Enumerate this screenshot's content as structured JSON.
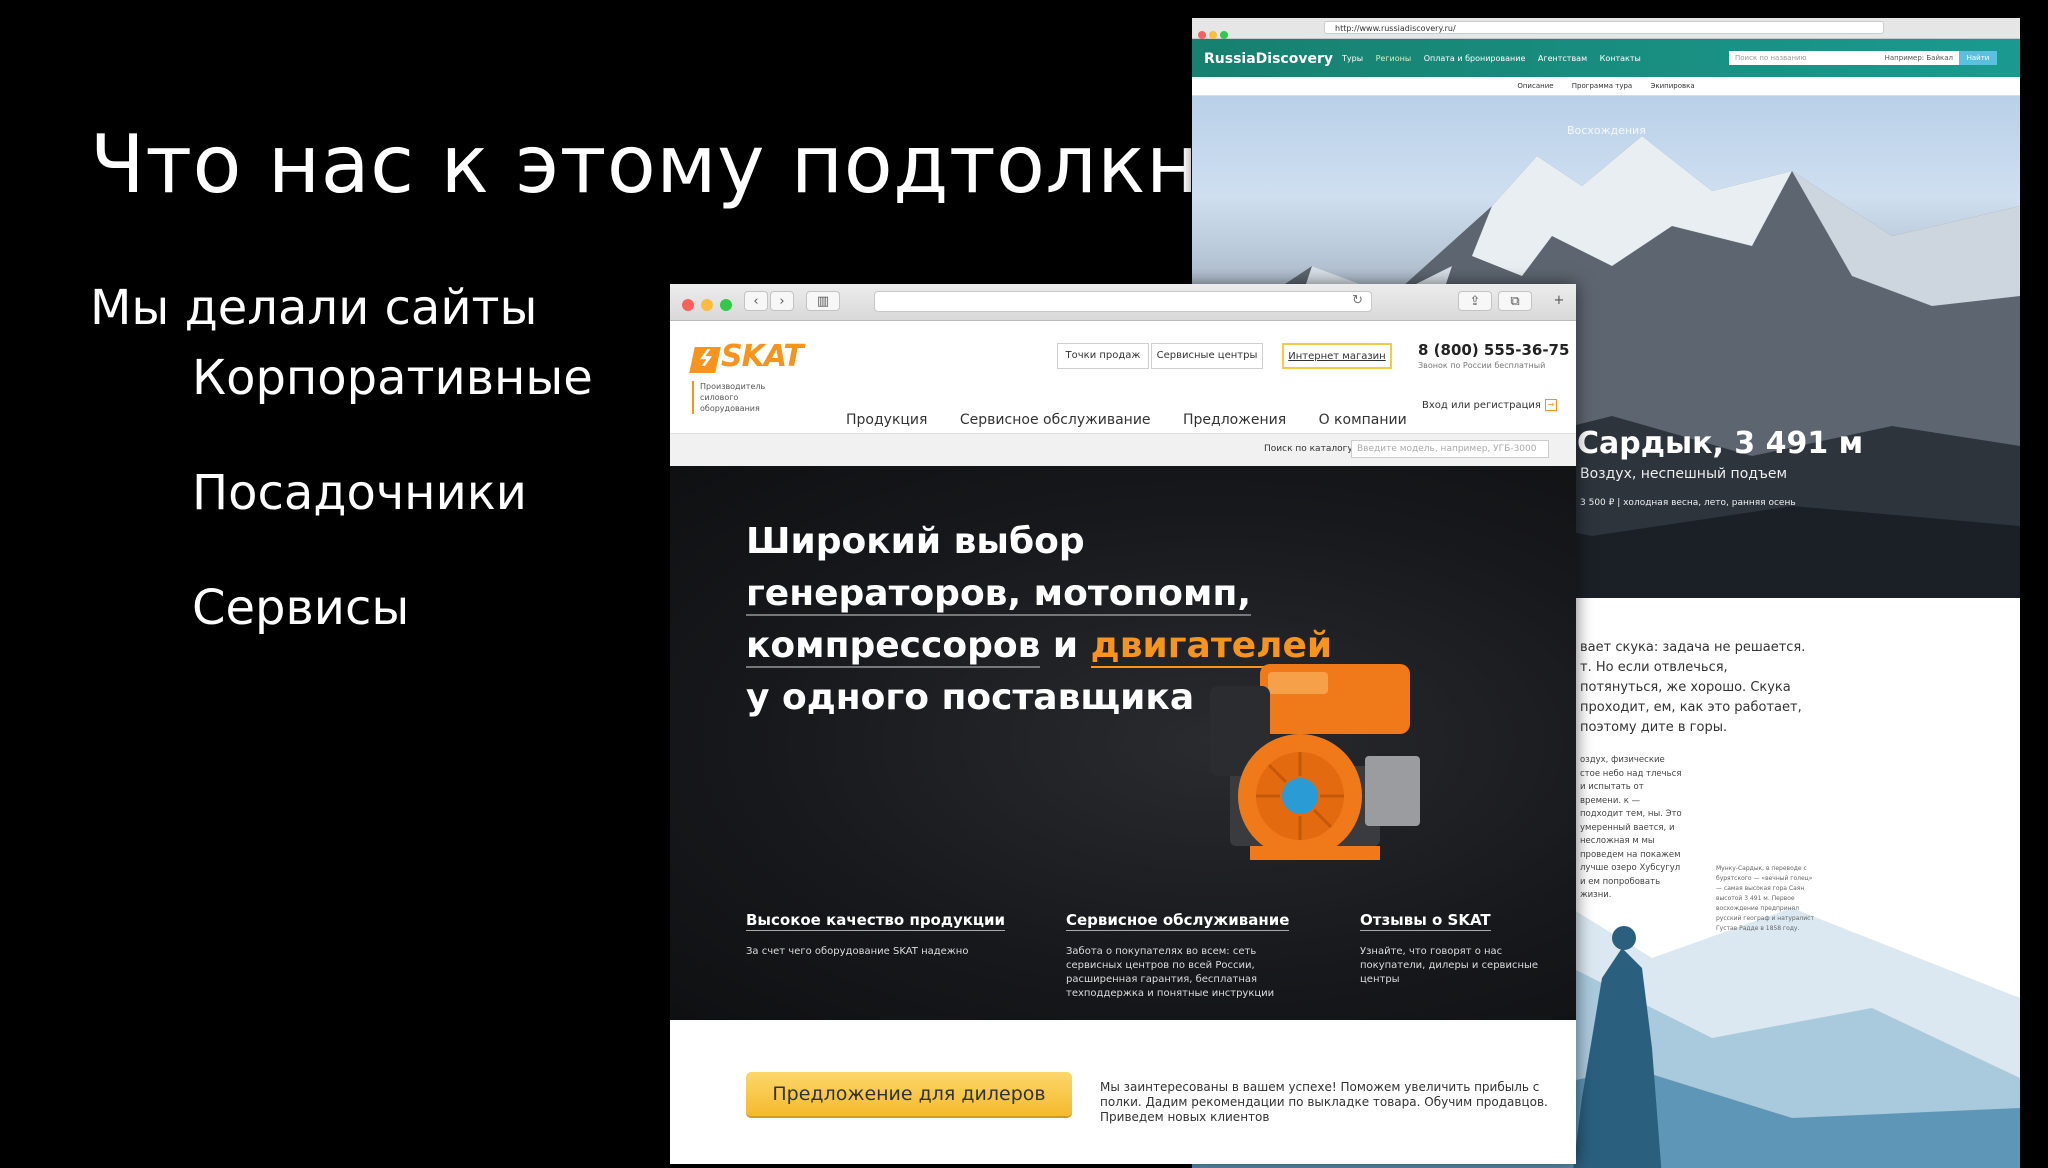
{
  "slide": {
    "title": "Что нас к этому подтолкнуло",
    "subtitle": "Мы делали сайты",
    "items": [
      "Корпоративные",
      "Посадочники",
      "Сервисы"
    ]
  },
  "back_site": {
    "url": "http://www.russiadiscovery.ru/",
    "logo": "RussiaDiscovery",
    "menu": [
      "Туры",
      "Регионы",
      "Оплата и бронирование",
      "Агентствам",
      "Контакты"
    ],
    "search_placeholder": "Поиск по названию",
    "search_label": "Например: Байкал",
    "search_button": "Найти",
    "subnav": [
      "Описание",
      "Программа тура",
      "Экипировка"
    ],
    "hero_top": "Восхождения",
    "hero_title": "Сардык, 3 491 м",
    "hero_subtitle": "Воздух, неспешный подъем",
    "hero_meta": "3 500 ₽   |   холодная весна, лето, ранняя осень",
    "body_text": "вает скука: задача не решается. т. Но если отвлечься, потянуться, же хорошо. Скука проходит, ем, как это работает, поэтому дите в горы.",
    "body_text2": "оздух, физические стое небо над тлечься и испытать от времени. к — подходит тем, ны. Это умеренный вается, и несложная м мы проведем на покажем лучше озеро Хубсугул и ем попробовать жизни.",
    "side_note": "Мунку-Сардык, в переводе с бурятского — «вечный голец» — самая высокая гора Саян высотой 3 491 м. Первое восхождение предпринял русский географ и натуралист Густав Радде в 1858 году."
  },
  "front_site": {
    "logo": "SKAT",
    "tagline": "Производитель силового оборудования",
    "top_buttons": [
      "Точки продаж",
      "Сервисные центры",
      "Интернет магазин"
    ],
    "phone": "8 (800) 555-36-75",
    "phone_note": "Звонок по России бесплатный",
    "login": "Вход или регистрация",
    "menu": [
      "Продукция",
      "Сервисное обслуживание",
      "Предложения",
      "О компании"
    ],
    "search_label": "Поиск по каталогу",
    "search_placeholder": "Введите модель, например, УГБ-3000",
    "hero_line1": "Широкий выбор",
    "hero_line2": "генераторов, мотопомп,",
    "hero_line3a": "компрессоров",
    "hero_line3b": " и ",
    "hero_line3c": "двигателей",
    "hero_line4": "у одного поставщика",
    "features": [
      {
        "title": "Высокое качество продукции",
        "desc": "За счет чего оборудование SKAT надежно"
      },
      {
        "title": "Сервисное обслуживание",
        "desc": "Забота о покупателях во всем: сеть сервисных центров по всей России, расширенная гарантия, бесплатная техподдержка и понятные инструкции"
      },
      {
        "title": "Отзывы о SKAT",
        "desc": "Узнайте, что говорят о нас покупатели, дилеры и сервисные центры"
      }
    ],
    "dealer_button": "Предложение для дилеров",
    "dealer_text": "Мы заинтересованы в вашем успехе! Поможем увеличить прибыль с полки. Дадим рекомендации по выкладке товара. Обучим продавцов. Приведем новых клиентов"
  },
  "colors": {
    "skat_orange": "#f7941d",
    "rd_teal": "#17806f",
    "dealer_yellow": "#f5b92e"
  }
}
